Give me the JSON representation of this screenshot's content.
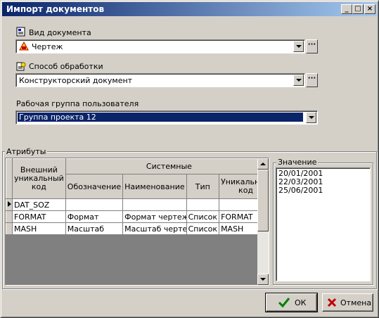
{
  "window": {
    "title": "Импорт документов"
  },
  "doc_type": {
    "label": "Вид документа",
    "value": "Чертеж"
  },
  "processing": {
    "label": "Способ обработки",
    "value": "Конструкторский документ"
  },
  "workgroup": {
    "label": "Рабочая группа пользователя",
    "value": "Группа проекта 12"
  },
  "attributes": {
    "label": "Атрибуты",
    "headers": {
      "external_code": "Внешний уникальный код",
      "system": "Системные",
      "designation": "Обозначение",
      "name": "Наименование",
      "type": "Тип",
      "unique_code": "Уникальный код"
    },
    "rows": [
      {
        "external": "DAT_SOZ",
        "designation": "",
        "name": "",
        "type": "",
        "unique": ""
      },
      {
        "external": "FORMAT",
        "designation": "Формат",
        "name": "Формат чертеж",
        "type": "Список",
        "unique": "FORMAT"
      },
      {
        "external": "MASH",
        "designation": "Масштаб",
        "name": "Масштаб чертеж",
        "type": "Список",
        "unique": "MASH"
      }
    ]
  },
  "values": {
    "label": "Значение",
    "items": [
      "20/01/2001",
      "22/03/2001",
      "25/06/2001"
    ]
  },
  "buttons": {
    "ok": "ОК",
    "cancel": "Отмена"
  }
}
